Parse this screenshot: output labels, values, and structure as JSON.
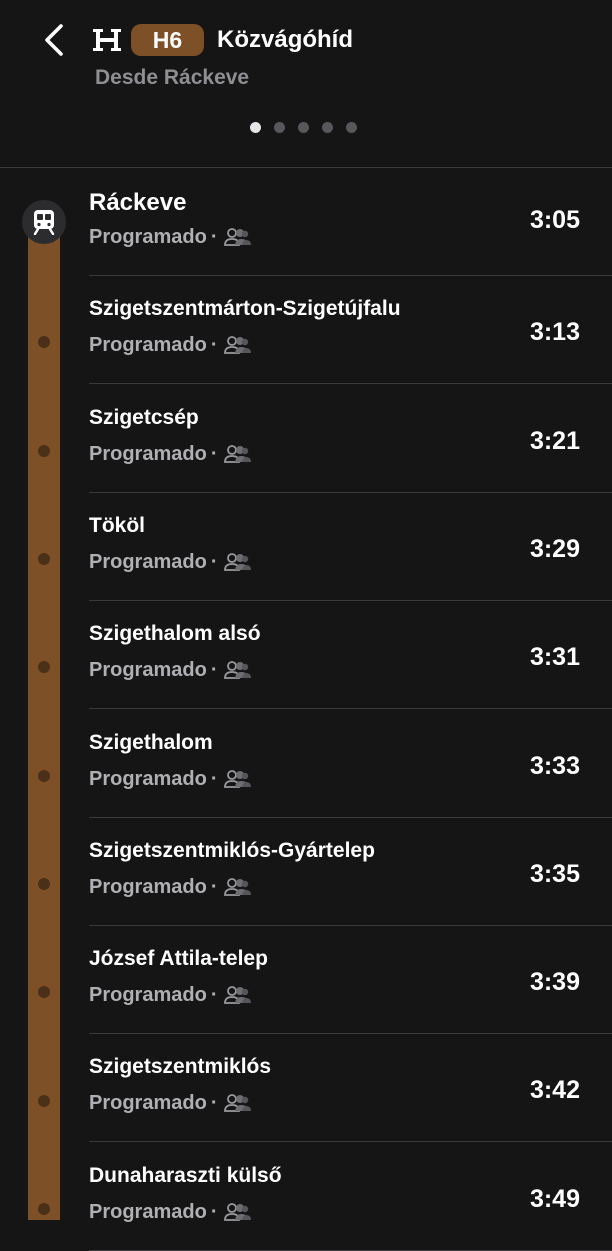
{
  "header": {
    "back_icon": "chevron-left-icon",
    "line_icon": "suburban-rail-icon",
    "route": "H6",
    "route_color": "#7d5028",
    "destination": "Közvágóhíd",
    "origin": "Desde Ráckeve",
    "pager": {
      "count": 5,
      "active": 0
    }
  },
  "stops": [
    {
      "name": "Ráckeve",
      "status": "Programado",
      "sep": "·",
      "time": "3:05"
    },
    {
      "name": "Szigetszentmárton-Szigetújfalu",
      "status": "Programado",
      "sep": "·",
      "time": "3:13"
    },
    {
      "name": "Szigetcsép",
      "status": "Programado",
      "sep": "·",
      "time": "3:21"
    },
    {
      "name": "Tököl",
      "status": "Programado",
      "sep": "·",
      "time": "3:29"
    },
    {
      "name": "Szigethalom alsó",
      "status": "Programado",
      "sep": "·",
      "time": "3:31"
    },
    {
      "name": "Szigethalom",
      "status": "Programado",
      "sep": "·",
      "time": "3:33"
    },
    {
      "name": "Szigetszentmiklós-Gyártelep",
      "status": "Programado",
      "sep": "·",
      "time": "3:35"
    },
    {
      "name": "József Attila-telep",
      "status": "Programado",
      "sep": "·",
      "time": "3:39"
    },
    {
      "name": "Szigetszentmiklós",
      "status": "Programado",
      "sep": "·",
      "time": "3:42"
    },
    {
      "name": "Dunaharaszti külső",
      "status": "Programado",
      "sep": "·",
      "time": "3:49"
    }
  ]
}
